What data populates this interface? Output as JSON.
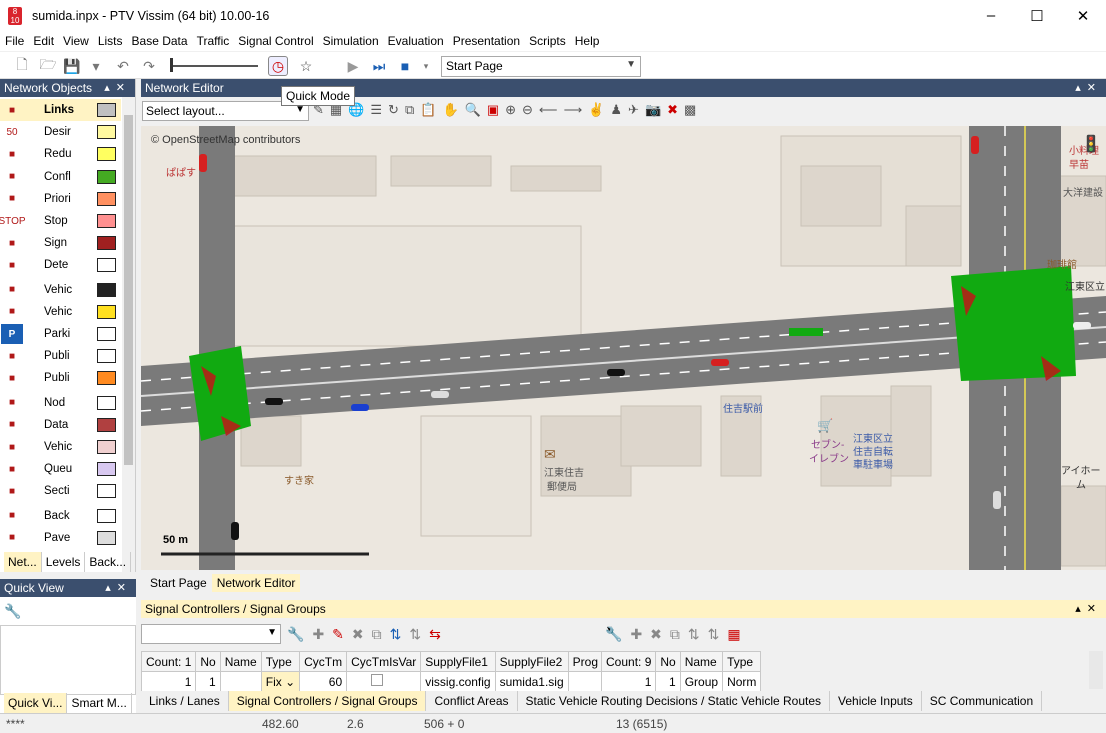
{
  "window": {
    "title": "sumida.inpx - PTV Vissim (64 bit) 10.00-16",
    "app_icon_text": "8\n10"
  },
  "menu": [
    "File",
    "Edit",
    "View",
    "Lists",
    "Base Data",
    "Traffic",
    "Signal Control",
    "Simulation",
    "Evaluation",
    "Presentation",
    "Scripts",
    "Help"
  ],
  "toolbar": {
    "start_page": "Start Page",
    "tooltip": "Quick Mode"
  },
  "network_objects": {
    "title": "Network Objects",
    "items": [
      {
        "label": "Links",
        "icon": "link-icon",
        "swatch": "#c0c0c0"
      },
      {
        "label": "Desir",
        "icon": "speed-sign-icon",
        "glyph": "50",
        "swatch": "#fff9a0"
      },
      {
        "label": "Redu",
        "icon": "reduced-speed-icon",
        "swatch": "#ffff60"
      },
      {
        "label": "Confl",
        "icon": "conflict-area-icon",
        "swatch": "#44aa22"
      },
      {
        "label": "Priori",
        "icon": "priority-rule-icon",
        "swatch": "#ff9060"
      },
      {
        "label": "Stop",
        "icon": "stop-sign-icon",
        "glyph": "STOP",
        "swatch": "#ff9090"
      },
      {
        "label": "Sign",
        "icon": "signal-head-icon",
        "swatch": "#a02020"
      },
      {
        "label": "Dete",
        "icon": "detector-icon",
        "swatch": "#ffffff"
      },
      {
        "label": "Vehic",
        "icon": "vehicle-input-icon",
        "swatch": "#222222"
      },
      {
        "label": "Vehic",
        "icon": "vehicle-route-icon",
        "swatch": "#ffe020"
      },
      {
        "label": "Parki",
        "icon": "parking-icon",
        "glyph": "P",
        "swatch": "#ffffff"
      },
      {
        "label": "Publi",
        "icon": "public-transport-stop-icon",
        "swatch": "#ffffff"
      },
      {
        "label": "Publi",
        "icon": "public-transport-line-icon",
        "swatch": "#ff8a20"
      },
      {
        "label": "Nod",
        "icon": "node-icon",
        "swatch": "#ffffff"
      },
      {
        "label": "Data",
        "icon": "data-collection-icon",
        "swatch": "#b04040"
      },
      {
        "label": "Vehic",
        "icon": "travel-time-icon",
        "swatch": "#f0d0d0"
      },
      {
        "label": "Queu",
        "icon": "queue-counter-icon",
        "swatch": "#d8c8f0"
      },
      {
        "label": "Secti",
        "icon": "section-icon",
        "swatch": "#ffffff"
      },
      {
        "label": "Back",
        "icon": "background-image-icon",
        "swatch": "#ffffff"
      },
      {
        "label": "Pave",
        "icon": "pavement-marking-icon",
        "swatch": "#dddddd"
      }
    ],
    "tabs": [
      "Net...",
      "Levels",
      "Back..."
    ]
  },
  "network_editor": {
    "title": "Network Editor",
    "layout_placeholder": "Select layout...",
    "osm_credit": "© OpenStreetMap contributors",
    "scale": "50 m",
    "map_labels": [
      "ぱぱす",
      "小料理",
      "早苗",
      "大洋建設",
      "珈琲館",
      "江東区立",
      "住吉駅前",
      "セブン-",
      "イレブン",
      "江東区立",
      "住吉自転",
      "車駐車場",
      "すき家",
      "江東住吉",
      "郵便局",
      "アイホー",
      "ム"
    ],
    "tabs": [
      "Start Page",
      "Network Editor"
    ]
  },
  "quick_view": {
    "title": "Quick View",
    "tabs": [
      "Quick Vi...",
      "Smart M..."
    ]
  },
  "signal_panel": {
    "title": "Signal Controllers / Signal Groups",
    "left_grid": {
      "headers": [
        "Count: 1",
        "No",
        "Name",
        "Type",
        "CycTm",
        "CycTmIsVar",
        "SupplyFile1",
        "SupplyFile2",
        "Prog"
      ],
      "row": [
        "1",
        "1",
        "",
        "Fix",
        "60",
        "",
        "vissig.config",
        "sumida1.sig",
        ""
      ]
    },
    "right_grid": {
      "headers": [
        "Count: 9",
        "No",
        "Name",
        "Type"
      ],
      "row": [
        "1",
        "1",
        "Group",
        "Norm"
      ]
    },
    "bottom_tabs": [
      "Links / Lanes",
      "Signal Controllers / Signal Groups",
      "Conflict Areas",
      "Static Vehicle Routing Decisions / Static Vehicle Routes",
      "Vehicle Inputs",
      "SC Communication"
    ]
  },
  "status": {
    "stars": "****",
    "x": "482.60",
    "y": "2.6",
    "pos": "506 + 0",
    "sim": "13 (6515)"
  }
}
